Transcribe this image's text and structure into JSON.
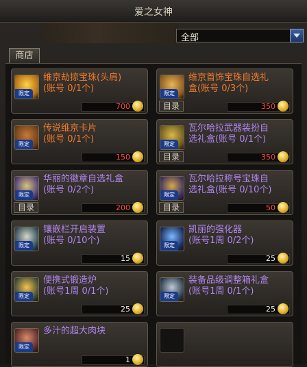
{
  "window": {
    "title": "爱之女神"
  },
  "filter": {
    "selected": "全部"
  },
  "tabs": {
    "shop": "商店"
  },
  "catalog_button": "目录",
  "limited_badge": "限定",
  "items": [
    {
      "name": [
        "维京劫掠宝珠(头肩)",
        "(账号 0/1个)"
      ],
      "rarity": "orange",
      "price": "700",
      "price_color": "red",
      "catalog": false
    },
    {
      "name": [
        "维京首饰宝珠自选礼",
        "盒(账号 0/3个)"
      ],
      "rarity": "orange",
      "price": "350",
      "price_color": "red",
      "catalog": true
    },
    {
      "name": [
        "传说维京卡片",
        "(账号 0/1个)"
      ],
      "rarity": "orange",
      "price": "150",
      "price_color": "red",
      "catalog": false
    },
    {
      "name": [
        "瓦尔哈拉武器装扮自",
        "选礼盒(账号 0/1个)"
      ],
      "rarity": "purple",
      "price": "350",
      "price_color": "red",
      "catalog": true
    },
    {
      "name": [
        "华丽的徽章自选礼盒",
        "(账号 0/2个)"
      ],
      "rarity": "purple",
      "price": "200",
      "price_color": "red",
      "catalog": true
    },
    {
      "name": [
        "瓦尔哈拉称号宝珠自",
        "选礼盒(账号 0/10个)"
      ],
      "rarity": "purple",
      "price": "50",
      "price_color": "red",
      "catalog": true
    },
    {
      "name": [
        "镶嵌栏开启装置",
        "(账号 0/10个)"
      ],
      "rarity": "purple",
      "price": "15",
      "price_color": "white",
      "catalog": false
    },
    {
      "name": [
        "凯丽的强化器",
        "(账号1周 0/2个)"
      ],
      "rarity": "purple",
      "price": "25",
      "price_color": "white",
      "catalog": false
    },
    {
      "name": [
        "便携式锻造炉",
        "(账号1周 0/1个)"
      ],
      "rarity": "purple",
      "price": "25",
      "price_color": "white",
      "catalog": false
    },
    {
      "name": [
        "装备品级调整箱礼盒",
        "(账号1周 0/1个)"
      ],
      "rarity": "purple",
      "price": "25",
      "price_color": "white",
      "catalog": false
    },
    {
      "name": [
        "多汁的超大肉块",
        ""
      ],
      "rarity": "purple",
      "price": "1",
      "price_color": "white",
      "catalog": false
    }
  ],
  "icons": [
    "orb-icon",
    "chest-icon",
    "card-icon",
    "weapon-box-icon",
    "badge-icon",
    "title-orb-icon",
    "socket-device-icon",
    "enhancer-icon",
    "forge-icon",
    "grade-box-icon",
    "meat-icon"
  ]
}
